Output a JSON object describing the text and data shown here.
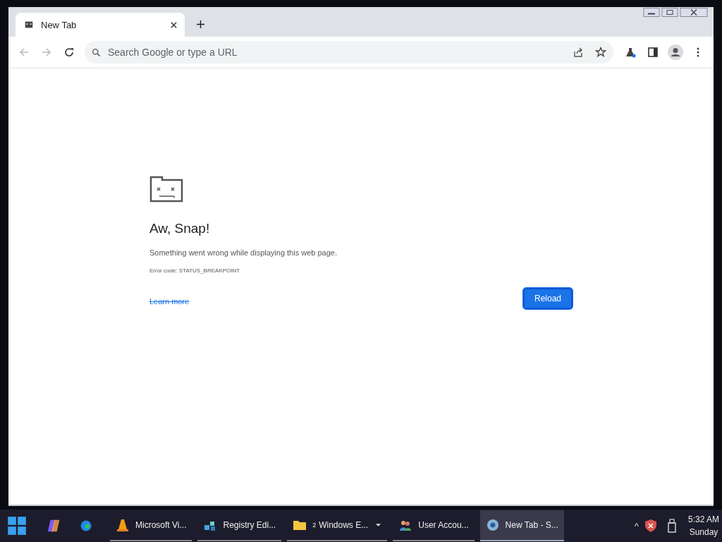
{
  "browser": {
    "tabs": [
      {
        "title": "New Tab",
        "selected": true
      }
    ],
    "omnibox": {
      "placeholder": "Search Google or type a URL"
    },
    "nav": {
      "back_disabled": true,
      "forward_disabled": true
    }
  },
  "error_page": {
    "title": "Aw, Snap!",
    "message": "Something went wrong while displaying this web page.",
    "error_code": "Error code: STATUS_BREAKPOINT",
    "link": "Learn more",
    "button": "Reload"
  },
  "taskbar": {
    "apps": [
      {
        "kind": "vlc",
        "label": "Microsoft Vi...",
        "selected": false
      },
      {
        "kind": "registry",
        "label": "Registry Edi...",
        "selected": false
      },
      {
        "kind": "folder",
        "count": "2",
        "label": "Windows E...",
        "selected": false
      },
      {
        "kind": "users",
        "label": "User Accou...",
        "selected": false
      },
      {
        "kind": "browser",
        "label": "New Tab - S...",
        "selected": true
      }
    ],
    "tray": {
      "expand": "^",
      "time": "5:32 AM",
      "day": "Sunday"
    }
  }
}
